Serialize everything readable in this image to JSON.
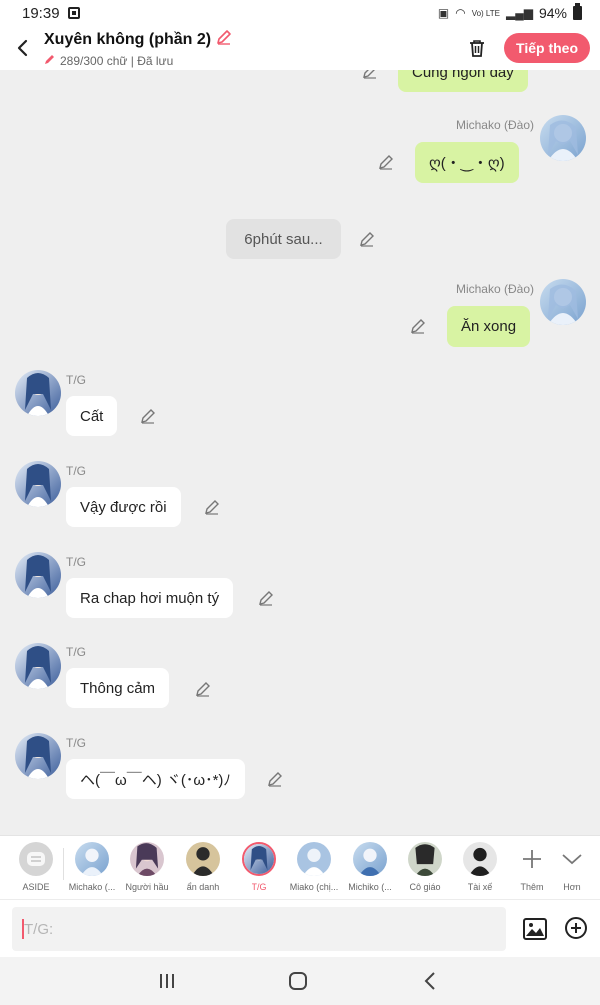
{
  "status_bar": {
    "time": "19:39",
    "battery": "94%",
    "network": "Vo) LTE"
  },
  "header": {
    "title": "Xuyên không (phần 2)",
    "subtitle": "289/300 chữ | Đã lưu",
    "next_button": "Tiếp theo"
  },
  "messages": [
    {
      "id": "m0",
      "side": "right",
      "text": "Cũng ngon đấy"
    },
    {
      "id": "m1",
      "side": "right",
      "name": "Michako (Đào)",
      "text": "ღ(・‿・ღ)"
    },
    {
      "id": "m2",
      "side": "center",
      "text": "6phút sau..."
    },
    {
      "id": "m3",
      "side": "right",
      "name": "Michako (Đào)",
      "text": "Ăn xong"
    },
    {
      "id": "m4",
      "side": "left",
      "name": "T/G",
      "text": "Cất"
    },
    {
      "id": "m5",
      "side": "left",
      "name": "T/G",
      "text": "Vậy được rồi"
    },
    {
      "id": "m6",
      "side": "left",
      "name": "T/G",
      "text": "Ra chap hơi muộn tý"
    },
    {
      "id": "m7",
      "side": "left",
      "name": "T/G",
      "text": "Thông cảm"
    },
    {
      "id": "m8",
      "side": "left",
      "name": "T/G",
      "text": "ヘ(￣ω￣ヘ) ヾ(･ω･*)ﾉ"
    }
  ],
  "characters": [
    {
      "label": "ASIDE",
      "active": false
    },
    {
      "label": "Michako (...",
      "active": false
    },
    {
      "label": "Người hầu",
      "active": false
    },
    {
      "label": "ẩn danh",
      "active": false
    },
    {
      "label": "T/G",
      "active": true
    },
    {
      "label": "Miako (chị...",
      "active": false
    },
    {
      "label": "Michiko (...",
      "active": false
    },
    {
      "label": "Cô giáo",
      "active": false
    },
    {
      "label": "Tài xế",
      "active": false
    },
    {
      "label": "Thêm",
      "active": false
    },
    {
      "label": "Hơn",
      "active": false
    }
  ],
  "input": {
    "placeholder": "T/G:"
  },
  "colors": {
    "accent": "#f25a6e",
    "bubble_green": "#d8f3a3",
    "background": "#efefef"
  },
  "icons": [
    "back-icon",
    "pencil-icon",
    "trash-icon",
    "edit-icon",
    "image-icon",
    "plus-circle-icon",
    "recents-icon",
    "home-icon",
    "nav-back-icon"
  ]
}
